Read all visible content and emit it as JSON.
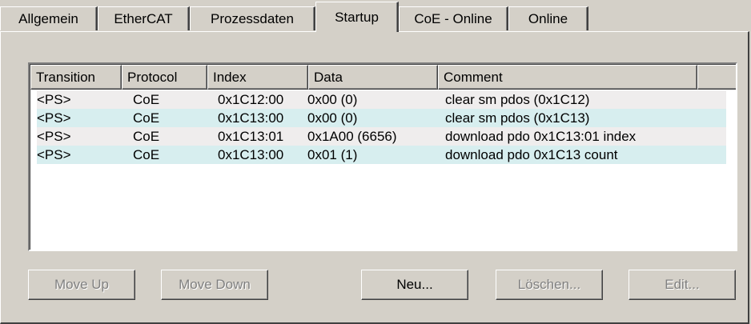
{
  "tabs": [
    {
      "label": "Allgemein",
      "active": false
    },
    {
      "label": "EtherCAT",
      "active": false
    },
    {
      "label": "Prozessdaten",
      "active": false
    },
    {
      "label": "Startup",
      "active": true
    },
    {
      "label": "CoE - Online",
      "active": false
    },
    {
      "label": "Online",
      "active": false
    }
  ],
  "table": {
    "columns": [
      "Transition",
      "Protocol",
      "Index",
      "Data",
      "Comment",
      ""
    ],
    "rows": [
      {
        "transition": "<PS>",
        "protocol": "CoE",
        "index": "0x1C12:00",
        "data": "0x00 (0)",
        "comment": "clear sm pdos (0x1C12)"
      },
      {
        "transition": "<PS>",
        "protocol": "CoE",
        "index": "0x1C13:00",
        "data": "0x00 (0)",
        "comment": "clear sm pdos (0x1C13)"
      },
      {
        "transition": "<PS>",
        "protocol": "CoE",
        "index": "0x1C13:01",
        "data": "0x1A00 (6656)",
        "comment": "download pdo 0x1C13:01 index"
      },
      {
        "transition": "<PS>",
        "protocol": "CoE",
        "index": "0x1C13:00",
        "data": "0x01 (1)",
        "comment": "download pdo 0x1C13 count"
      }
    ]
  },
  "buttons": {
    "move_up": "Move Up",
    "move_down": "Move Down",
    "new": "Neu...",
    "delete": "Löschen...",
    "edit": "Edit..."
  }
}
